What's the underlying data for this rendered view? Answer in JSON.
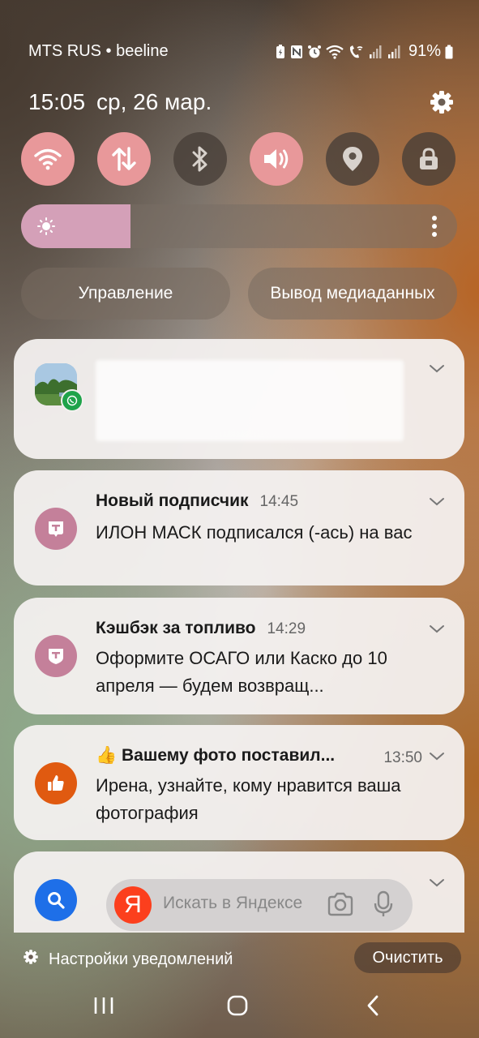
{
  "status_bar": {
    "carrier": "MTS RUS • beeline",
    "battery": "91%"
  },
  "header": {
    "time": "15:05",
    "date": "ср, 26 мар."
  },
  "quick_settings": [
    {
      "name": "wifi",
      "icon": "wifi-icon",
      "active": true
    },
    {
      "name": "mobile-data",
      "icon": "data-arrows-icon",
      "active": true
    },
    {
      "name": "bluetooth",
      "icon": "bluetooth-icon",
      "active": false
    },
    {
      "name": "sound",
      "icon": "volume-icon",
      "active": true
    },
    {
      "name": "location",
      "icon": "location-pin-icon",
      "active": false
    },
    {
      "name": "rotation-lock",
      "icon": "lock-icon",
      "active": false
    }
  ],
  "brightness": {
    "level": 0.25
  },
  "buttons": {
    "device_control": "Управление",
    "media_output": "Вывод медиаданных"
  },
  "notifications": [
    {
      "app": "whatsapp",
      "title": "",
      "time": "",
      "body": ""
    },
    {
      "app": "tbank",
      "title": "Новый подписчик",
      "time": "14:45",
      "body": "ИЛОН МАСК подписался (-ась) на вас"
    },
    {
      "app": "tbank",
      "title": "Кэшбэк за топливо",
      "time": "14:29",
      "body": "Оформите ОСАГО или Каско до 10 апреля — будем возвращ..."
    },
    {
      "app": "odnoklassniki",
      "title": "👍 Вашему фото поставил...",
      "time": "13:50",
      "body": "Ирена, узнайте, кому нравится ваша фотография"
    },
    {
      "app": "yandex",
      "search_placeholder": "Искать в Яндексе",
      "logo_letter": "Я"
    }
  ],
  "footer": {
    "notification_settings": "Настройки уведомлений",
    "clear": "Очистить"
  },
  "colors": {
    "qs_active": "#e8989a",
    "brightness_fill": "#d4a0b8",
    "tbank_icon": "#c4809a",
    "ok_icon": "#e05a10",
    "search_icon_bg": "#1e6fe8",
    "yandex_red": "#fc3f1d"
  }
}
